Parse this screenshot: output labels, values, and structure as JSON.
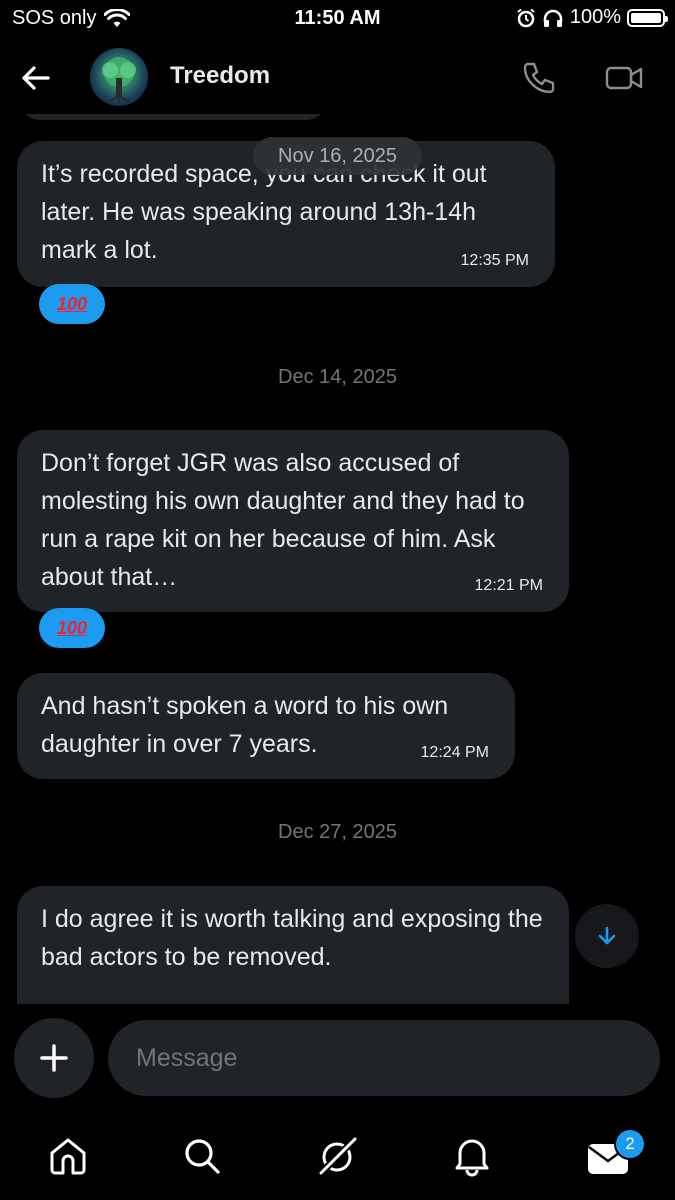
{
  "status_bar": {
    "carrier": "SOS only",
    "time": "11:50 AM",
    "battery": "100%"
  },
  "header": {
    "contact_name": "Treedom"
  },
  "conversation": {
    "floating_date": "Nov 16, 2025",
    "messages": [
      {
        "text": "It’s recorded space, you can check it out later.  He was speaking around 13h-14h mark a lot.",
        "time": "12:35 PM",
        "reaction": "100"
      },
      {
        "date": "Dec 14, 2025"
      },
      {
        "text": "Don’t forget JGR was also accused of molesting his own daughter and they had to run a rape kit on her because of him. Ask about that…",
        "time": "12:21 PM",
        "reaction": "100"
      },
      {
        "text": "And hasn’t spoken a word to his own daughter in over 7 years.",
        "time": "12:24 PM"
      },
      {
        "date": "Dec 27, 2025"
      },
      {
        "text": "I do agree it is worth talking and exposing the bad actors to be removed."
      }
    ]
  },
  "composer": {
    "placeholder": "Message"
  },
  "tabbar": {
    "messages_badge": "2"
  },
  "colors": {
    "accent": "#1d9bf0",
    "bubble": "#202327",
    "background": "#000000"
  }
}
